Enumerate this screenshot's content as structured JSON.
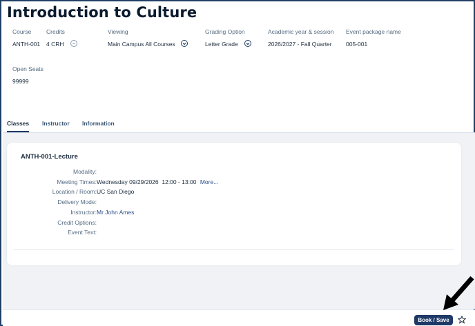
{
  "page": {
    "title": "Introduction to Culture"
  },
  "summary": {
    "course": {
      "label": "Course",
      "value": "ANTH-001"
    },
    "credits": {
      "label": "Credits",
      "value": "4 CRH"
    },
    "viewing": {
      "label": "Viewing",
      "value": "Main Campus All Courses"
    },
    "grading": {
      "label": "Grading Option",
      "value": "Letter Grade"
    },
    "session": {
      "label": "Academic year & session",
      "value": "2026/2027 - Fall Quarter"
    },
    "event_package": {
      "label": "Event package name",
      "value": "005-001"
    },
    "open_seats": {
      "label": "Open Seats",
      "value": "99999"
    }
  },
  "tabs": [
    {
      "label": "Classes",
      "active": true
    },
    {
      "label": "Instructor",
      "active": false
    },
    {
      "label": "Information",
      "active": false
    }
  ],
  "class_card": {
    "title": "ANTH-001-Lecture",
    "rows": [
      {
        "label": "Modality:",
        "value": ""
      },
      {
        "label": "Meeting Times:",
        "value": "Wednesday 09/29/2026  12:00 - 13:00",
        "link": "More..."
      },
      {
        "label": "Location / Room:",
        "value": "UC San Diego"
      },
      {
        "label": "Delivery Mode:",
        "value": ""
      },
      {
        "label": "Instructor:",
        "value": "Mr John Ames"
      },
      {
        "label": "Credit Options:",
        "value": ""
      },
      {
        "label": "Event Text:",
        "value": ""
      }
    ]
  },
  "footer": {
    "book_label": "Book / Save"
  },
  "icons": {
    "viewing_dropdown": "chevron-down-circle-icon",
    "grading_dropdown": "chevron-down-circle-icon",
    "credits_toggle": "minus-circle-icon",
    "favorite": "star-icon",
    "annotation": "arrow-icon"
  },
  "colors": {
    "accent": "#1f3a66",
    "frame": "#1f3f66",
    "content_bg": "#f0f2f5"
  }
}
